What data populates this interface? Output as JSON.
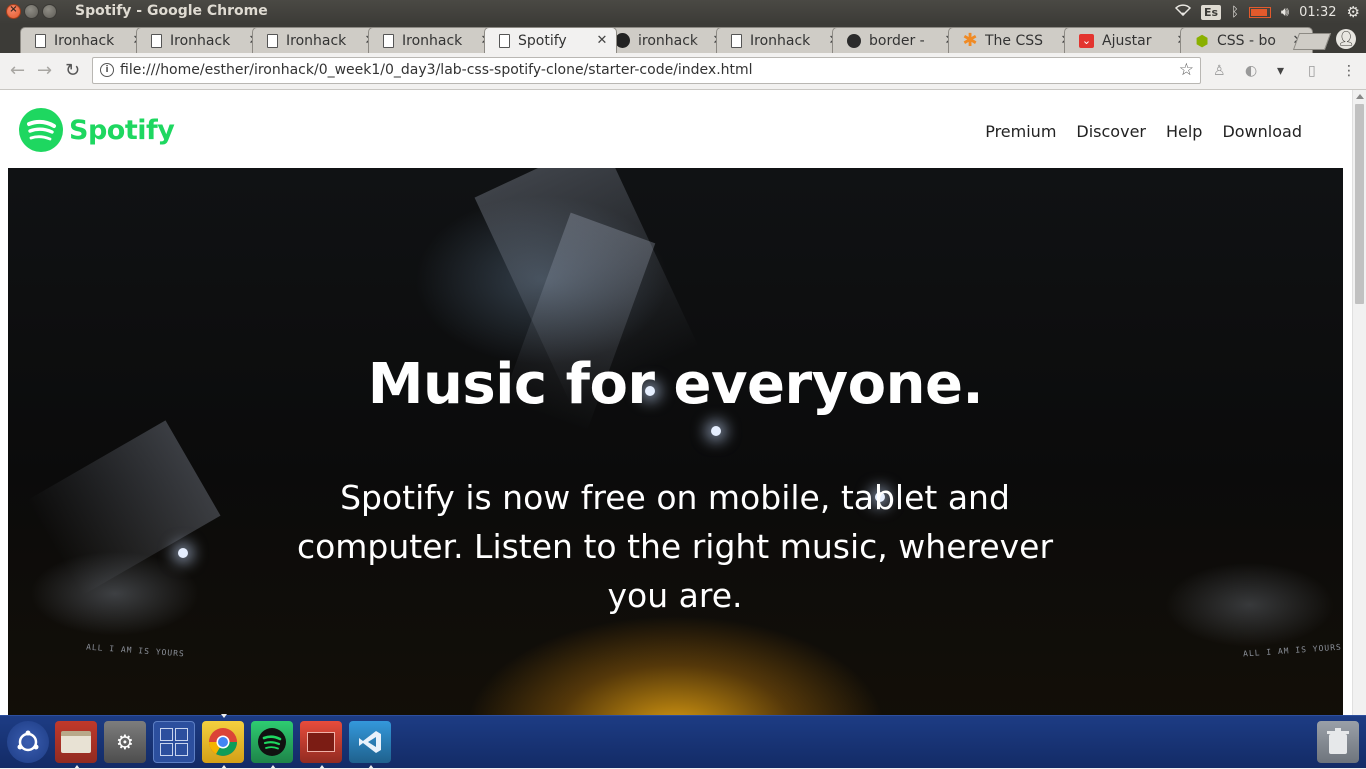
{
  "window": {
    "title": "Spotify - Google Chrome"
  },
  "system_tray": {
    "keyboard_layout": "Es",
    "clock": "01:32"
  },
  "tabs": [
    {
      "label": "Ironhack",
      "favicon": "document-icon",
      "active": false
    },
    {
      "label": "Ironhack",
      "favicon": "document-icon",
      "active": false
    },
    {
      "label": "Ironhack",
      "favicon": "document-icon",
      "active": false
    },
    {
      "label": "Ironhack",
      "favicon": "document-icon",
      "active": false
    },
    {
      "label": "Spotify",
      "favicon": "document-icon",
      "active": true
    },
    {
      "label": "ironhack",
      "favicon": "github-icon",
      "active": false
    },
    {
      "label": "Ironhack",
      "favicon": "document-icon",
      "active": false
    },
    {
      "label": "border -",
      "favicon": "css-site-icon",
      "active": false
    },
    {
      "label": "The CSS",
      "favicon": "css-tricks-icon",
      "active": false
    },
    {
      "label": "Ajustar",
      "favicon": "pocket-icon",
      "active": false
    },
    {
      "label": "CSS - bo",
      "favicon": "android-icon",
      "active": false
    }
  ],
  "address_bar": {
    "url": "file:///home/esther/ironhack/0_week1/0_day3/lab-css-spotify-clone/starter-code/index.html"
  },
  "page": {
    "logo_text": "Spotify",
    "nav": [
      "Premium",
      "Discover",
      "Help",
      "Download"
    ],
    "hero_title": "Music for everyone.",
    "hero_subtitle": "Spotify is now free on mobile, tablet and computer. Listen to the right music, wherever you are.",
    "screen_text_left": "ALL I AM IS YOURS",
    "screen_text_right": "ALL I AM IS YOURS"
  },
  "colors": {
    "spotify_green": "#1ed760",
    "launcher_blue": "#1d3c84",
    "hero_glow": "#e0a012"
  },
  "launcher": [
    {
      "name": "ubuntu-home-icon"
    },
    {
      "name": "file-manager-icon"
    },
    {
      "name": "system-settings-icon"
    },
    {
      "name": "workspace-switcher-icon"
    },
    {
      "name": "chrome-icon"
    },
    {
      "name": "spotify-icon"
    },
    {
      "name": "terminal-app-icon"
    },
    {
      "name": "vscode-icon"
    },
    {
      "name": "trash-icon"
    }
  ]
}
